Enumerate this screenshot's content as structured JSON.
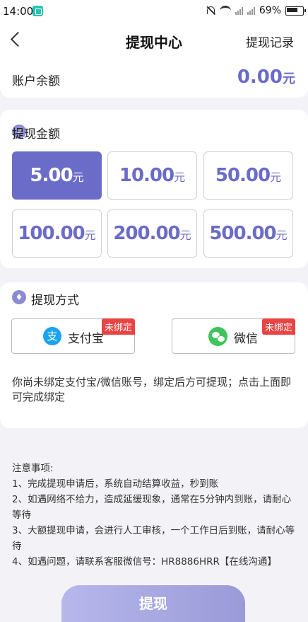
{
  "status_bar": {
    "time": "14:00",
    "battery": "69%"
  },
  "nav": {
    "title": "提现中心",
    "right_link": "提现记录"
  },
  "balance": {
    "label": "账户余额",
    "amount": "0.00",
    "unit": "元"
  },
  "amount_section": {
    "title": "提现金额",
    "icon_glyph": "¥",
    "unit": "元",
    "options": [
      "5.00",
      "10.00",
      "50.00",
      "100.00",
      "200.00",
      "500.00"
    ],
    "selected_index": 0
  },
  "method_section": {
    "title": "提现方式",
    "methods": [
      {
        "name": "支付宝",
        "icon_glyph": "支",
        "badge": "未绑定",
        "icon": "alipay-icon"
      },
      {
        "name": "微信",
        "badge": "未绑定",
        "icon": "wechat-icon"
      }
    ],
    "tip": "你尚未绑定支付宝/微信账号，绑定后方可提现；点击上面即可完成绑定"
  },
  "notes": {
    "title": "注意事项:",
    "items": [
      "1、完成提现申请后，系统自动结算收益，秒到账",
      "2、如遇网络不给力，造成延缓现象，通常在5分钟内到账，请耐心等待",
      "3、大额提现申请，会进行人工审核，一个工作日后到账，请耐心等待",
      "4、如遇问题，请联系客服微信号：HR8886HRR【在线沟通】"
    ]
  },
  "submit_label": "提现",
  "colors": {
    "accent": "#6b6bc8",
    "badge": "#e84444",
    "alipay": "#1aa3f0",
    "wechat": "#3fc35a"
  }
}
